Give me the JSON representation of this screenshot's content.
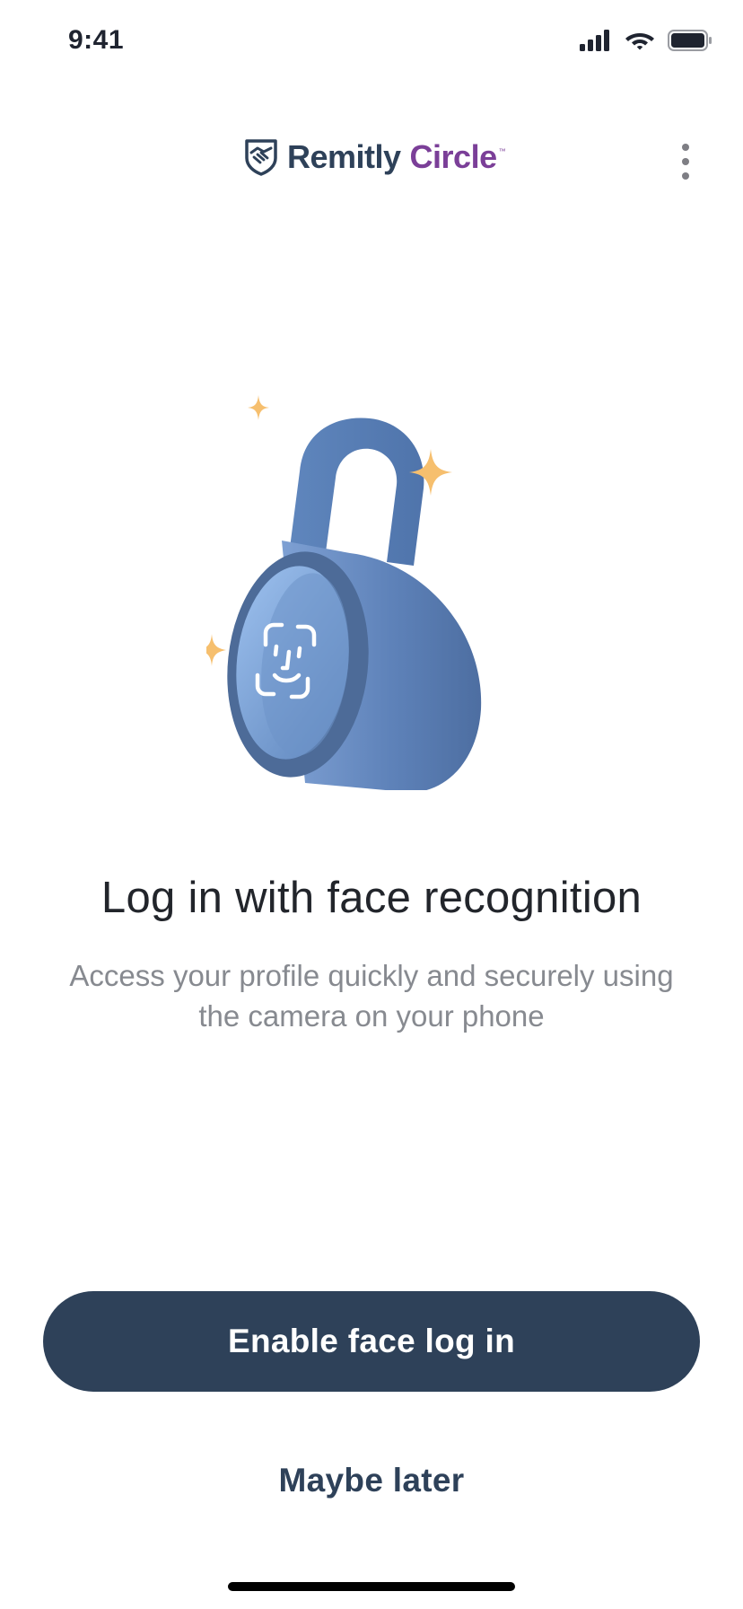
{
  "status_bar": {
    "time": "9:41",
    "icons": [
      "cellular-signal-icon",
      "wifi-icon",
      "battery-icon"
    ]
  },
  "header": {
    "logo_main": "Remitly",
    "logo_accent": "Circle",
    "logo_tm": "™",
    "menu_icon": "more-vertical-icon"
  },
  "illustration": {
    "icons": [
      "padlock-icon",
      "face-id-icon",
      "sparkle-icon"
    ],
    "colors": {
      "lock_body": "#5f86bd",
      "lock_dark": "#4d6b98",
      "lock_face": "#8fb0e0",
      "sparkle": "#f6bf6e"
    }
  },
  "main": {
    "title": "Log in with face recognition",
    "subtitle": "Access your profile quickly and securely using the camera on your phone"
  },
  "actions": {
    "primary_label": "Enable face log in",
    "secondary_label": "Maybe later"
  },
  "colors": {
    "brand_dark": "#2e4159",
    "brand_purple": "#7b3f98",
    "subtitle_gray": "#878a90"
  }
}
